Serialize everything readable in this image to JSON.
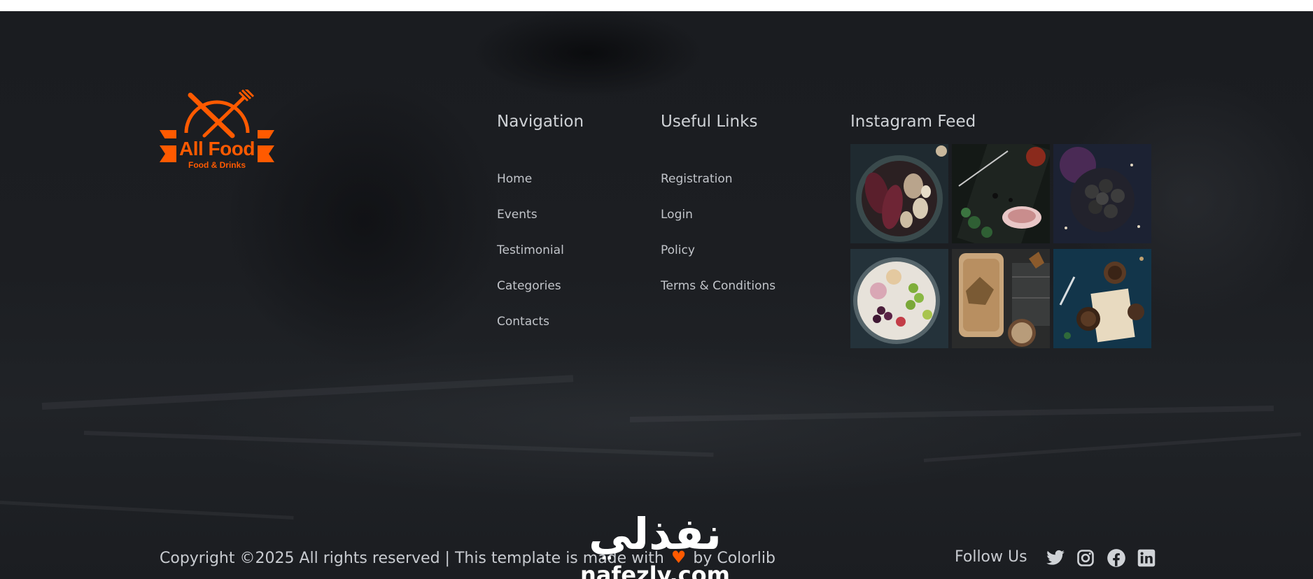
{
  "brand": {
    "name": "All Food",
    "tagline": "Food & Drinks",
    "color": "#ff5a00"
  },
  "navigation": {
    "title": "Navigation",
    "items": [
      "Home",
      "Events",
      "Testimonial",
      "Categories",
      "Contacts"
    ]
  },
  "useful_links": {
    "title": "Useful Links",
    "items": [
      "Registration",
      "Login",
      "Policy",
      "Terms & Conditions"
    ]
  },
  "instagram": {
    "title": "Instagram Feed",
    "images": [
      "roasted-beets-photo",
      "cured-salmon-board-photo",
      "dark-truffles-photo",
      "grapes-platter-photo",
      "bread-autumn-leaves-photo",
      "chocolate-muffins-photo"
    ]
  },
  "copyright": {
    "text_before": "Copyright ©2025 All rights reserved | This template is made with",
    "heart_icon": "heart-icon",
    "text_after": "by Colorlib"
  },
  "social": {
    "label": "Follow Us",
    "icons": [
      "twitter-icon",
      "instagram-icon",
      "facebook-icon",
      "linkedin-icon"
    ]
  },
  "watermark": {
    "arabic": "نفذلي",
    "latin": "nafezly.com"
  }
}
